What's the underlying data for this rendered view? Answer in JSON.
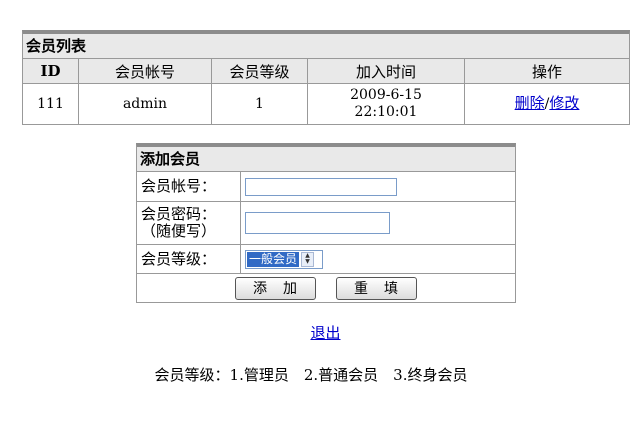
{
  "member_list": {
    "title": "会员列表",
    "headers": [
      "ID",
      "会员帐号",
      "会员等级",
      "加入时间",
      "操作"
    ],
    "rows": [
      {
        "id": "111",
        "account": "admin",
        "level": "1",
        "join_date": "2009-6-15",
        "join_time": "22:10:01",
        "delete_label": "删除",
        "separator": "/",
        "edit_label": "修改"
      }
    ]
  },
  "add_member": {
    "title": "添加会员",
    "account_label": "会员帐号：",
    "account_value": "",
    "password_label_line1": "会员密码：",
    "password_label_line2": "（随便写）",
    "password_value": "",
    "level_label": "会员等级：",
    "level_selected": "一般会员",
    "add_button": "添　加",
    "reset_button": "重　填"
  },
  "logout_link": "退出",
  "level_legend": "会员等级：1.管理员　2.普通会员　3.终身会员",
  "colors": {
    "header_bg": "#e9e9e9",
    "border": "#999999",
    "link": "#0000cc",
    "select_highlight": "#316ac5"
  }
}
